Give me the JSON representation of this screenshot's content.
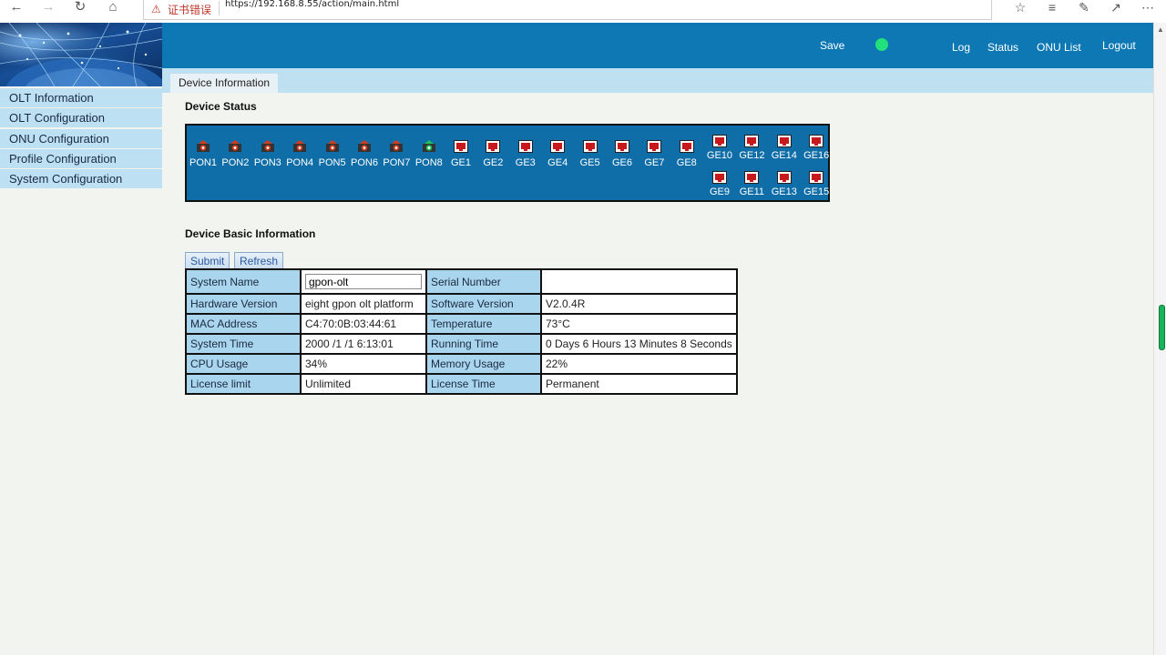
{
  "browser": {
    "cert_error": "证书错误",
    "url": "https://192.168.8.55/action/main.html"
  },
  "header": {
    "save": "Save",
    "log": "Log",
    "status": "Status",
    "onu_list": "ONU List",
    "logout": "Logout",
    "status_dot_color": "#22e07a"
  },
  "tab": {
    "label": "Device Information"
  },
  "sidebar": {
    "items": [
      {
        "label": "OLT Information"
      },
      {
        "label": "OLT Configuration"
      },
      {
        "label": "ONU Configuration"
      },
      {
        "label": "Profile Configuration"
      },
      {
        "label": "System Configuration"
      }
    ]
  },
  "device_status": {
    "title": "Device Status",
    "pon_ports": [
      {
        "label": "PON1",
        "state": "down"
      },
      {
        "label": "PON2",
        "state": "down"
      },
      {
        "label": "PON3",
        "state": "down"
      },
      {
        "label": "PON4",
        "state": "down"
      },
      {
        "label": "PON5",
        "state": "down"
      },
      {
        "label": "PON6",
        "state": "down"
      },
      {
        "label": "PON7",
        "state": "down"
      },
      {
        "label": "PON8",
        "state": "up"
      }
    ],
    "ge_ports": [
      {
        "label": "GE1",
        "state": "down"
      },
      {
        "label": "GE2",
        "state": "down"
      },
      {
        "label": "GE3",
        "state": "down"
      },
      {
        "label": "GE4",
        "state": "down"
      },
      {
        "label": "GE5",
        "state": "down"
      },
      {
        "label": "GE6",
        "state": "down"
      },
      {
        "label": "GE7",
        "state": "down"
      },
      {
        "label": "GE8",
        "state": "down"
      }
    ],
    "uplink_top": [
      {
        "label": "GE10",
        "state": "down"
      },
      {
        "label": "GE12",
        "state": "down"
      },
      {
        "label": "GE14",
        "state": "down"
      },
      {
        "label": "GE16",
        "state": "down"
      }
    ],
    "uplink_bottom": [
      {
        "label": "GE9",
        "state": "down"
      },
      {
        "label": "GE11",
        "state": "down"
      },
      {
        "label": "GE13",
        "state": "down"
      },
      {
        "label": "GE15",
        "state": "down"
      }
    ]
  },
  "basic_info": {
    "title": "Device Basic Information",
    "submit": "Submit",
    "refresh": "Refresh",
    "system_name_label": "System Name",
    "system_name_value": "gpon-olt",
    "serial_number_label": "Serial Number",
    "serial_number_value": "",
    "rows": [
      {
        "l1": "Hardware Version",
        "v1": "eight gpon olt platform",
        "l2": "Software Version",
        "v2": "V2.0.4R"
      },
      {
        "l1": "MAC Address",
        "v1": "C4:70:0B:03:44:61",
        "l2": "Temperature",
        "v2": "73°C"
      },
      {
        "l1": "System Time",
        "v1": "2000 /1 /1 6:13:01",
        "l2": "Running Time",
        "v2": "0 Days 6 Hours 13 Minutes 8 Seconds"
      },
      {
        "l1": "CPU Usage",
        "v1": "34%",
        "l2": "Memory Usage",
        "v2": "22%"
      },
      {
        "l1": "License limit",
        "v1": "Unlimited",
        "l2": "License Time",
        "v2": "Permanent"
      }
    ]
  }
}
